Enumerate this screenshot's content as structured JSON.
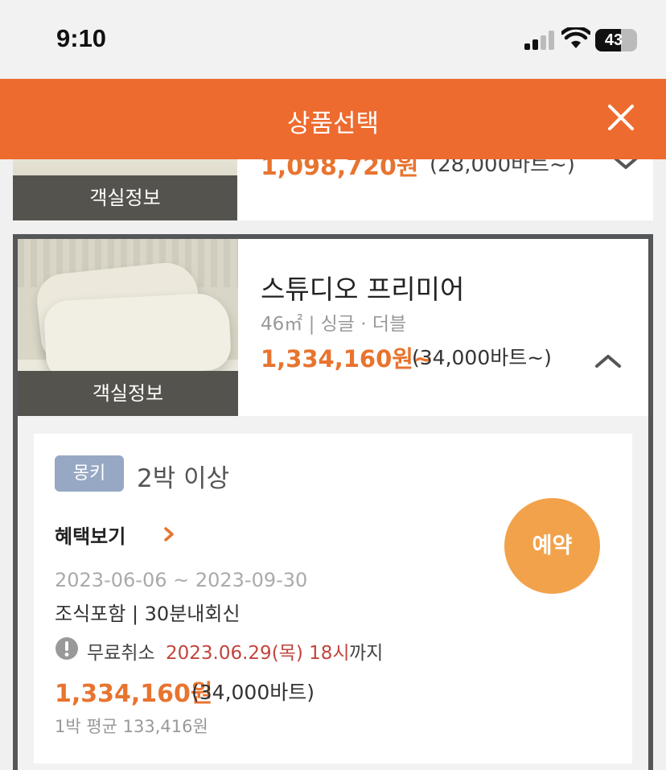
{
  "status_bar": {
    "time": "9:10",
    "battery_level": "43",
    "icons": [
      "signal-icon",
      "wifi-icon",
      "battery-icon"
    ]
  },
  "header": {
    "title": "상품선택",
    "close_icon": "close-icon",
    "background": "#ee6b2f"
  },
  "previous_room": {
    "info_label": "객실정보",
    "price": "1,098,720원",
    "price_sub": "(28,000바트~)"
  },
  "room": {
    "name": "스튜디오 프리미어",
    "meta": "46㎡ | 싱글 · 더블",
    "price": "1,334,160원~",
    "price_sub": "(34,000바트~)",
    "info_label": "객실정보",
    "expanded": true
  },
  "rate": {
    "badge": "몽키",
    "stay": "2박 이상",
    "benefit_label": "혜택보기",
    "reserve_label": "예약",
    "period": "2023-06-06 ~ 2023-09-30",
    "terms": "조식포함 | 30분내회신",
    "cancel_label": "무료취소",
    "cancel_date": "2023.06.29(목) 18시",
    "cancel_until": "까지",
    "price": "1,334,160원",
    "price_sub": "(34,000바트)",
    "average": "1박 평균 133,416원"
  },
  "colors": {
    "accent": "#e8742f",
    "reserve": "#f2a24b",
    "badge": "#96a8c3",
    "cancel_date": "#c2453d",
    "border": "#55565a"
  }
}
